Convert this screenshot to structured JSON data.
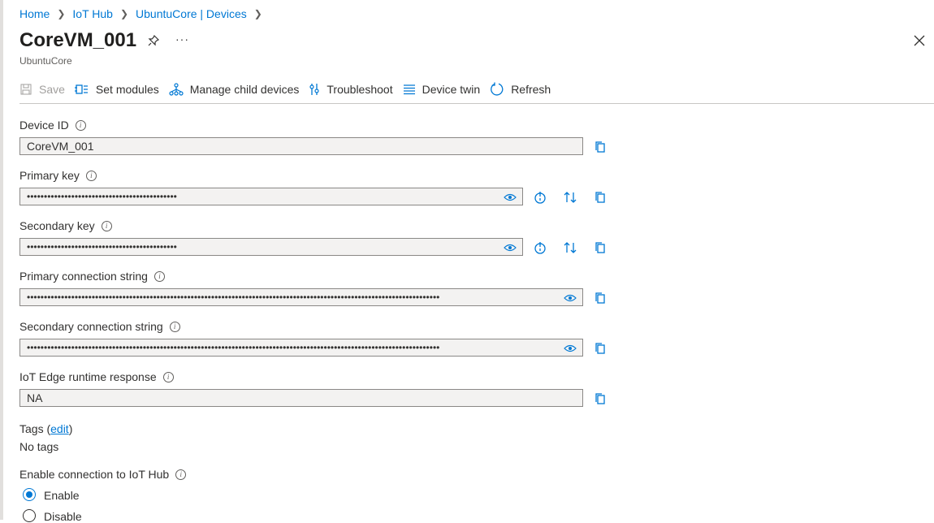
{
  "breadcrumb": [
    "Home",
    "IoT Hub",
    "UbuntuCore | Devices"
  ],
  "header": {
    "title": "CoreVM_001",
    "subtitle": "UbuntuCore",
    "more": "···"
  },
  "toolbar": {
    "save": "Save",
    "set_modules": "Set modules",
    "manage_child": "Manage child devices",
    "troubleshoot": "Troubleshoot",
    "device_twin": "Device twin",
    "refresh": "Refresh"
  },
  "fields": {
    "device_id": {
      "label": "Device ID",
      "value": "CoreVM_001"
    },
    "primary_key": {
      "label": "Primary key",
      "value": "••••••••••••••••••••••••••••••••••••••••••••"
    },
    "secondary_key": {
      "label": "Secondary key",
      "value": "••••••••••••••••••••••••••••••••••••••••••••"
    },
    "primary_conn": {
      "label": "Primary connection string",
      "value": "•••••••••••••••••••••••••••••••••••••••••••••••••••••••••••••••••••••••••••••••••••••••••••••••••••••••••••••••••••••••••"
    },
    "secondary_conn": {
      "label": "Secondary connection string",
      "value": "•••••••••••••••••••••••••••••••••••••••••••••••••••••••••••••••••••••••••••••••••••••••••••••••••••••••••••••••••••••••••"
    },
    "edge_runtime": {
      "label": "IoT Edge runtime response",
      "value": "NA"
    }
  },
  "tags": {
    "label": "Tags (",
    "edit": "edit",
    "close": ")",
    "value": "No tags"
  },
  "connection": {
    "label": "Enable connection to IoT Hub",
    "enable": "Enable",
    "disable": "Disable",
    "selected": "Enable"
  },
  "colors": {
    "accent": "#0078d4",
    "field_bg": "#f3f2f1"
  }
}
